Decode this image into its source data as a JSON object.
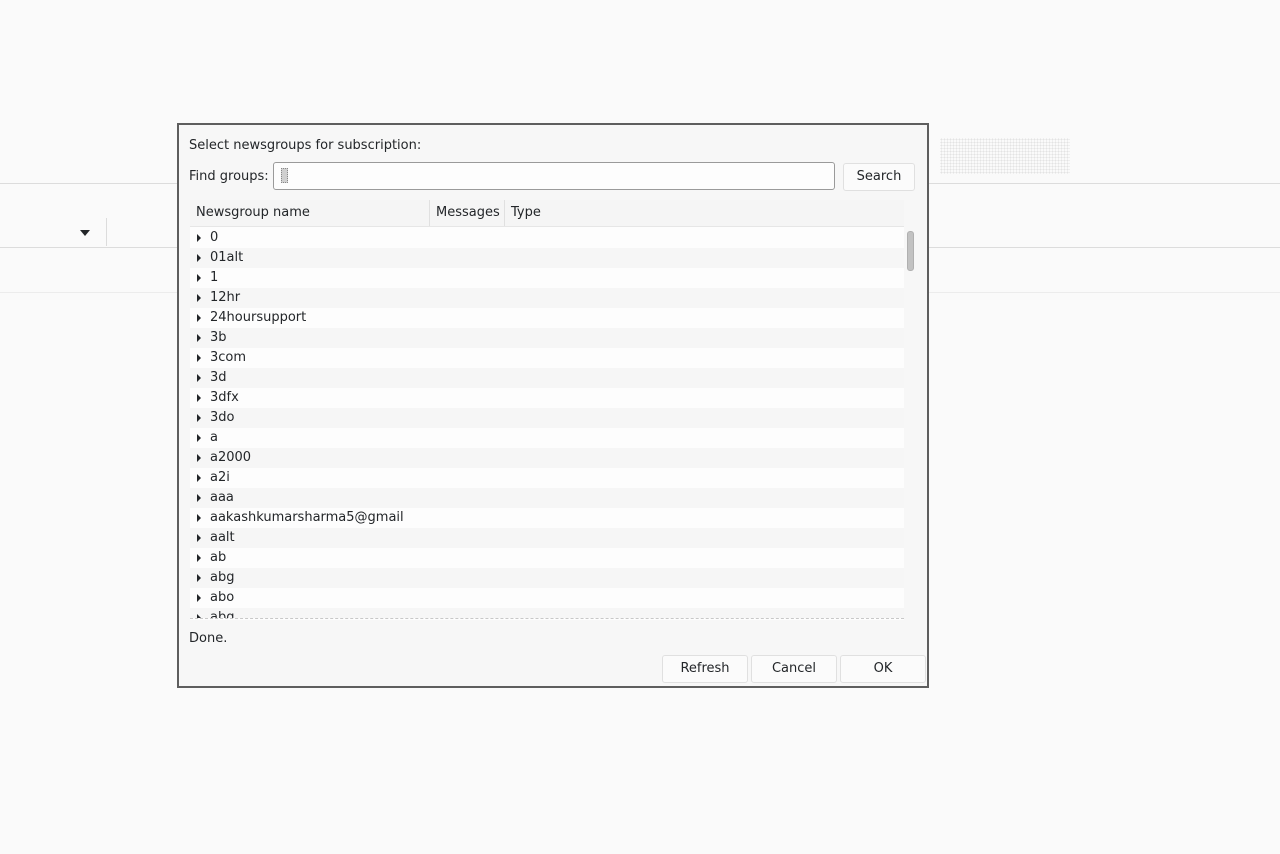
{
  "dialog": {
    "prompt": "Select newsgroups for subscription:",
    "find_label": "Find groups:",
    "find_value": "",
    "search_label": "Search",
    "status": "Done.",
    "buttons": {
      "refresh": "Refresh",
      "cancel": "Cancel",
      "ok": "OK"
    }
  },
  "tree": {
    "columns": [
      "Newsgroup name",
      "Messages",
      "Type"
    ],
    "rows": [
      "0",
      "01alt",
      "1",
      "12hr",
      "24hoursupport",
      "3b",
      "3com",
      "3d",
      "3dfx",
      "3do",
      "a",
      "a2000",
      "a2i",
      "aaa",
      "aakashkumarsharma5@gmail",
      "aalt",
      "ab",
      "abg",
      "abo",
      "abq"
    ]
  },
  "icons": {
    "row_expander": "chevron-right-icon",
    "background_dropdown": "chevron-down-icon"
  }
}
